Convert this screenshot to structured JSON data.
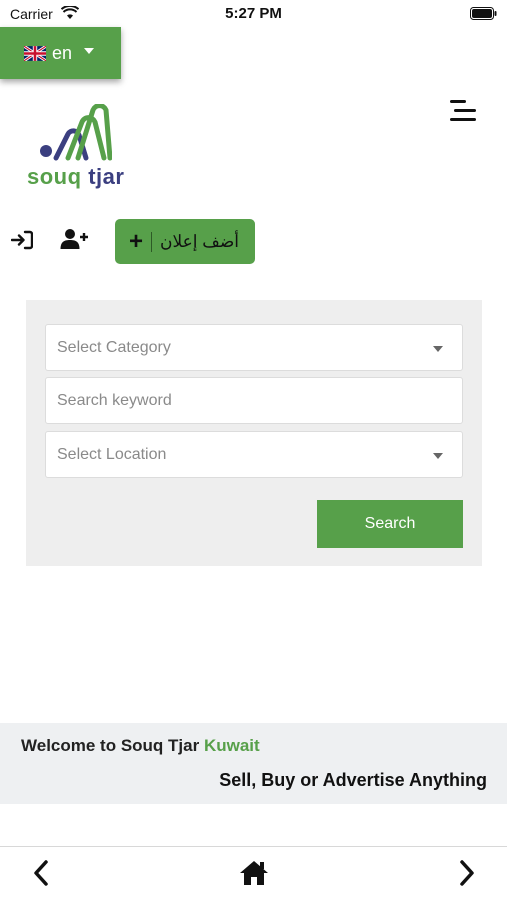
{
  "status_bar": {
    "carrier": "Carrier",
    "time": "5:27 PM"
  },
  "language": {
    "label": "en",
    "flag": "uk-flag-icon"
  },
  "header": {
    "menu_icon": "menu-icon"
  },
  "logo": {
    "word1": "souq",
    "word2": "tjar"
  },
  "actions": {
    "login_icon": "sign-in-icon",
    "register_icon": "user-plus-icon",
    "post_ad_label": "أضف إعلان"
  },
  "search": {
    "category_placeholder": "Select Category",
    "keyword_placeholder": "Search keyword",
    "location_placeholder": "Select Location",
    "button_label": "Search"
  },
  "welcome": {
    "prefix": "Welcome to Souq Tjar",
    "country": "Kuwait",
    "tagline": "Sell, Buy or Advertise Anything"
  },
  "bottom_nav": {
    "back": "chevron-left-icon",
    "home": "home-icon",
    "forward": "chevron-right-icon"
  },
  "colors": {
    "brand_green": "#57a04a",
    "brand_blue": "#3b3f80",
    "panel_bg": "#eeeeee",
    "band_bg": "#eef0f2"
  }
}
